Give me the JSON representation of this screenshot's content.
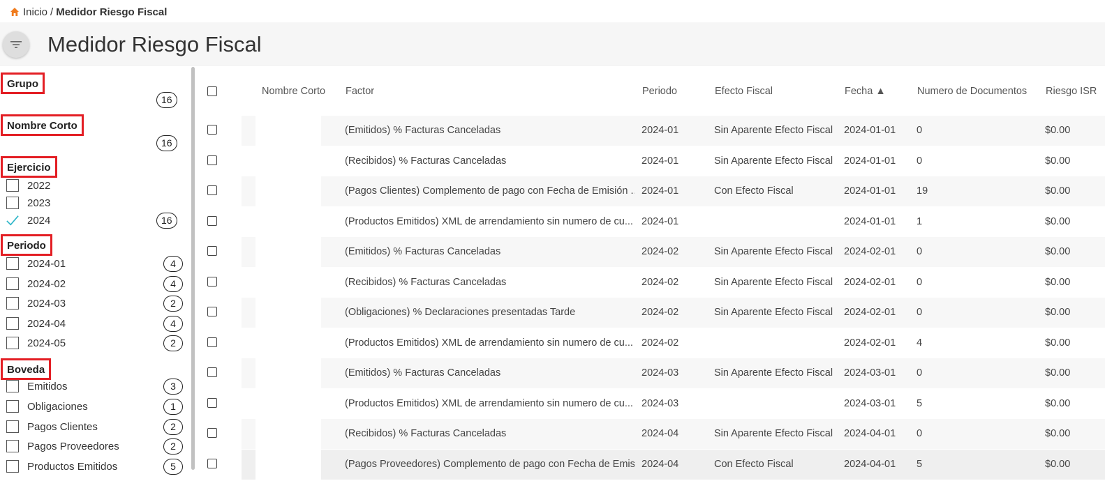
{
  "breadcrumb": {
    "home": "Inicio",
    "separator": "/",
    "current": "Medidor Riesgo Fiscal"
  },
  "page": {
    "title": "Medidor Riesgo Fiscal"
  },
  "filters": {
    "grupo": {
      "title": "Grupo",
      "count": "16"
    },
    "nombre_corto": {
      "title": "Nombre Corto",
      "count": "16"
    },
    "ejercicio": {
      "title": "Ejercicio",
      "items": [
        {
          "label": "2022",
          "checked": false,
          "count": ""
        },
        {
          "label": "2023",
          "checked": false,
          "count": ""
        },
        {
          "label": "2024",
          "checked": true,
          "count": "16"
        }
      ]
    },
    "periodo": {
      "title": "Periodo",
      "items": [
        {
          "label": "2024-01",
          "count": "4"
        },
        {
          "label": "2024-02",
          "count": "4"
        },
        {
          "label": "2024-03",
          "count": "2"
        },
        {
          "label": "2024-04",
          "count": "4"
        },
        {
          "label": "2024-05",
          "count": "2"
        }
      ]
    },
    "boveda": {
      "title": "Boveda",
      "items": [
        {
          "label": "Emitidos",
          "count": "3"
        },
        {
          "label": "Obligaciones",
          "count": "1"
        },
        {
          "label": "Pagos Clientes",
          "count": "2"
        },
        {
          "label": "Pagos Proveedores",
          "count": "2"
        },
        {
          "label": "Productos Emitidos",
          "count": "5"
        }
      ]
    }
  },
  "table": {
    "columns": {
      "nombre_corto": "Nombre Corto",
      "factor": "Factor",
      "periodo": "Periodo",
      "efecto": "Efecto Fiscal",
      "fecha": "Fecha ▲",
      "numdocs": "Numero de Documentos",
      "riesgo": "Riesgo ISR"
    },
    "rows": [
      {
        "factor": "(Emitidos) % Facturas Canceladas",
        "periodo": "2024-01",
        "efecto": "Sin Aparente Efecto Fiscal",
        "fecha": "2024-01-01",
        "numdocs": "0",
        "riesgo": "$0.00"
      },
      {
        "factor": "(Recibidos) % Facturas Canceladas",
        "periodo": "2024-01",
        "efecto": "Sin Aparente Efecto Fiscal",
        "fecha": "2024-01-01",
        "numdocs": "0",
        "riesgo": "$0.00"
      },
      {
        "factor": "(Pagos Clientes) Complemento de pago con Fecha de Emisión ...",
        "periodo": "2024-01",
        "efecto": "Con Efecto Fiscal",
        "fecha": "2024-01-01",
        "numdocs": "19",
        "riesgo": "$0.00"
      },
      {
        "factor": "(Productos Emitidos) XML de arrendamiento sin numero de cu...",
        "periodo": "2024-01",
        "efecto": "",
        "fecha": "2024-01-01",
        "numdocs": "1",
        "riesgo": "$0.00"
      },
      {
        "factor": "(Emitidos) % Facturas Canceladas",
        "periodo": "2024-02",
        "efecto": "Sin Aparente Efecto Fiscal",
        "fecha": "2024-02-01",
        "numdocs": "0",
        "riesgo": "$0.00"
      },
      {
        "factor": "(Recibidos) % Facturas Canceladas",
        "periodo": "2024-02",
        "efecto": "Sin Aparente Efecto Fiscal",
        "fecha": "2024-02-01",
        "numdocs": "0",
        "riesgo": "$0.00"
      },
      {
        "factor": "(Obligaciones) % Declaraciones presentadas Tarde",
        "periodo": "2024-02",
        "efecto": "Sin Aparente Efecto Fiscal",
        "fecha": "2024-02-01",
        "numdocs": "0",
        "riesgo": "$0.00"
      },
      {
        "factor": "(Productos Emitidos) XML de arrendamiento sin numero de cu...",
        "periodo": "2024-02",
        "efecto": "",
        "fecha": "2024-02-01",
        "numdocs": "4",
        "riesgo": "$0.00"
      },
      {
        "factor": "(Emitidos) % Facturas Canceladas",
        "periodo": "2024-03",
        "efecto": "Sin Aparente Efecto Fiscal",
        "fecha": "2024-03-01",
        "numdocs": "0",
        "riesgo": "$0.00"
      },
      {
        "factor": "(Productos Emitidos) XML de arrendamiento sin numero de cu...",
        "periodo": "2024-03",
        "efecto": "",
        "fecha": "2024-03-01",
        "numdocs": "5",
        "riesgo": "$0.00"
      },
      {
        "factor": "(Recibidos) % Facturas Canceladas",
        "periodo": "2024-04",
        "efecto": "Sin Aparente Efecto Fiscal",
        "fecha": "2024-04-01",
        "numdocs": "0",
        "riesgo": "$0.00"
      },
      {
        "factor": "(Pagos Proveedores) Complemento de pago con Fecha de Emis...",
        "periodo": "2024-04",
        "efecto": "Con Efecto Fiscal",
        "fecha": "2024-04-01",
        "numdocs": "5",
        "riesgo": "$0.00"
      }
    ]
  },
  "colors": {
    "accent_red": "#e31e24",
    "check_teal": "#2bb5c8",
    "home_orange": "#f07c1e"
  },
  "icons": {
    "home": "home-icon",
    "filter": "filter-icon",
    "check": "check-icon"
  }
}
